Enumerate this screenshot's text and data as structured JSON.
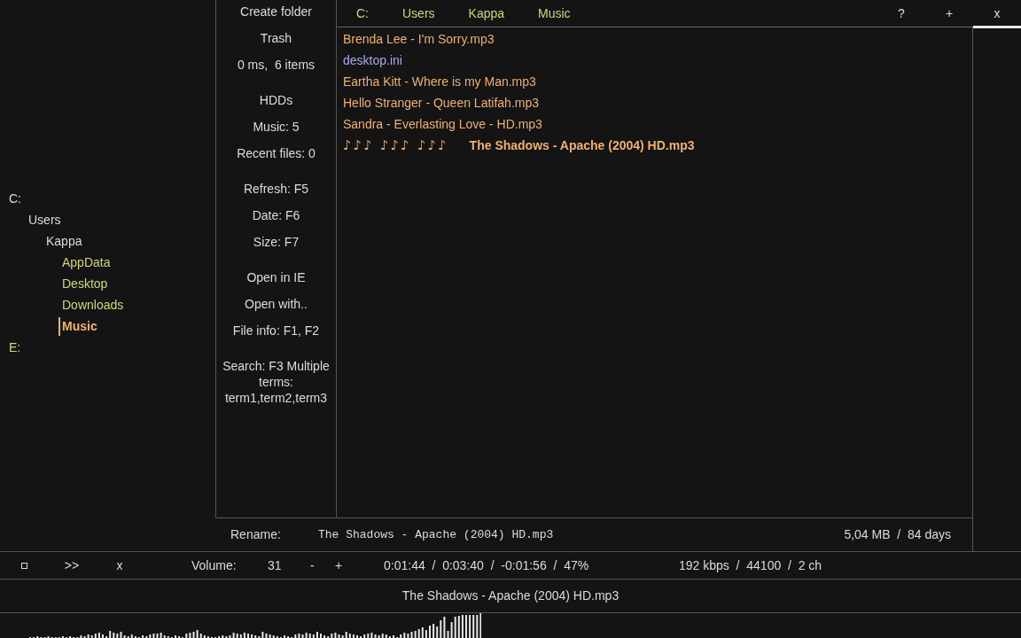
{
  "tree": [
    {
      "label": "C:",
      "expanded": true,
      "selected": false,
      "children": [
        {
          "label": "Users",
          "expanded": true,
          "selected": false,
          "children": [
            {
              "label": "Kappa",
              "expanded": true,
              "selected": false,
              "children": [
                {
                  "label": "AppData",
                  "expanded": false,
                  "selected": false
                },
                {
                  "label": "Desktop",
                  "expanded": false,
                  "selected": false
                },
                {
                  "label": "Downloads",
                  "expanded": false,
                  "selected": false
                },
                {
                  "label": "Music",
                  "expanded": false,
                  "selected": true
                }
              ]
            }
          ]
        }
      ]
    },
    {
      "label": "E:",
      "expanded": false,
      "selected": false
    }
  ],
  "actions": [
    [
      "Create folder",
      "Trash",
      "0 ms,  6 items"
    ],
    [
      "HDDs",
      "Music: 5",
      "Recent files: 0"
    ],
    [
      "Refresh: F5",
      "Date: F6",
      "Size: F7"
    ],
    [
      "Open in IE",
      "Open with..",
      "File info: F1, F2"
    ],
    [
      "Search: F3 Multiple terms: term1,term2,term3"
    ]
  ],
  "breadcrumb": [
    "C:",
    "Users",
    "Kappa",
    "Music"
  ],
  "top_buttons": [
    "?",
    "+",
    "x"
  ],
  "files": [
    {
      "name": "Brenda Lee - I'm Sorry.mp3",
      "kind": "audio",
      "playing": false
    },
    {
      "name": "desktop.ini",
      "kind": "other",
      "playing": false
    },
    {
      "name": "Eartha Kitt - Where is my Man.mp3",
      "kind": "audio",
      "playing": false
    },
    {
      "name": "Hello Stranger - Queen Latifah.mp3",
      "kind": "audio",
      "playing": false
    },
    {
      "name": "Sandra - Everlasting Love - HD.mp3",
      "kind": "audio",
      "playing": false
    },
    {
      "name": "The Shadows - Apache (2004) HD.mp3",
      "kind": "audio",
      "playing": true,
      "notes": "♪♪♪ ♪♪♪ ♪♪♪"
    }
  ],
  "rename": {
    "label": "Rename:",
    "value": "The Shadows - Apache (2004) HD.mp3",
    "info": "5,04 MB  /  84 days"
  },
  "player": {
    "controls": [
      ">>",
      "x"
    ],
    "volume_label": "Volume:",
    "volume": "31",
    "volume_buttons": [
      "-",
      "+"
    ],
    "time": "0:01:44  /  0:03:40  /  -0:01:56  /  47%",
    "stream": "192 kbps  /  44100  /  2 ch"
  },
  "now_playing": "The Shadows - Apache (2004) HD.mp3"
}
